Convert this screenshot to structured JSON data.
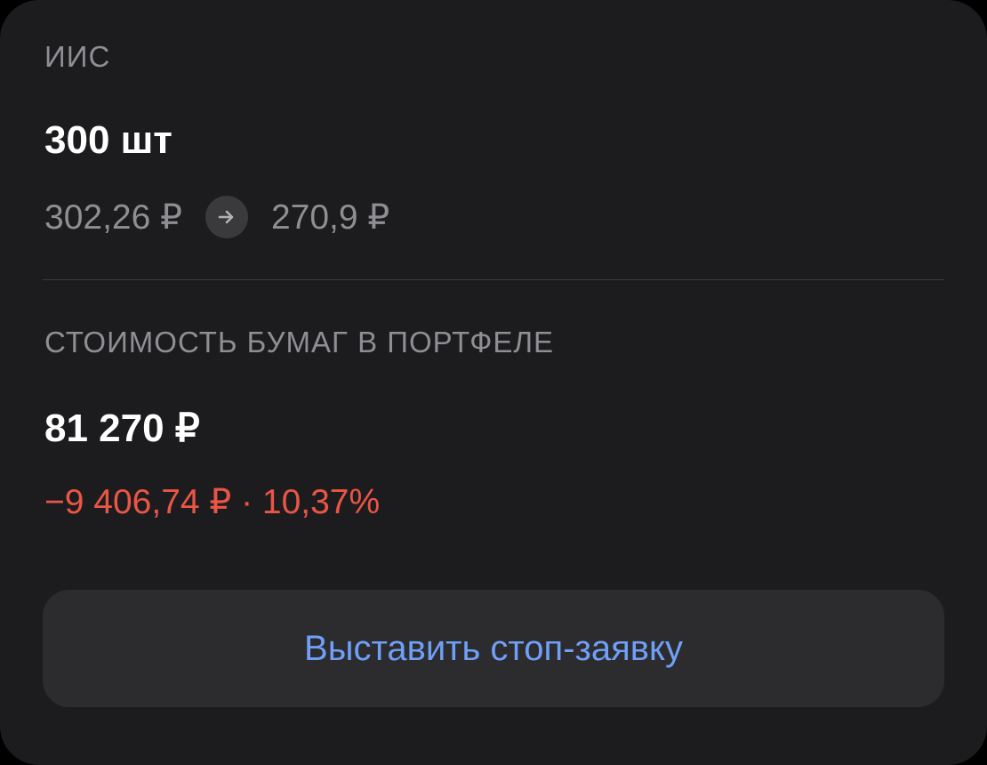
{
  "position": {
    "account_label": "ИИС",
    "quantity": "300 шт",
    "avg_price": "302,26 ₽",
    "current_price": "270,9 ₽",
    "arrow_icon": "arrow-right-icon"
  },
  "portfolio": {
    "label": "СТОИМОСТЬ БУМАГ В ПОРТФЕЛЕ",
    "value": "81 270 ₽",
    "pl_amount": "−9 406,74 ₽",
    "pl_separator": " · ",
    "pl_percent": "10,37%"
  },
  "actions": {
    "stop_order_label": "Выставить стоп-заявку"
  },
  "colors": {
    "background": "#1c1c1e",
    "loss": "#eb5545",
    "accent": "#6f9ff7"
  }
}
